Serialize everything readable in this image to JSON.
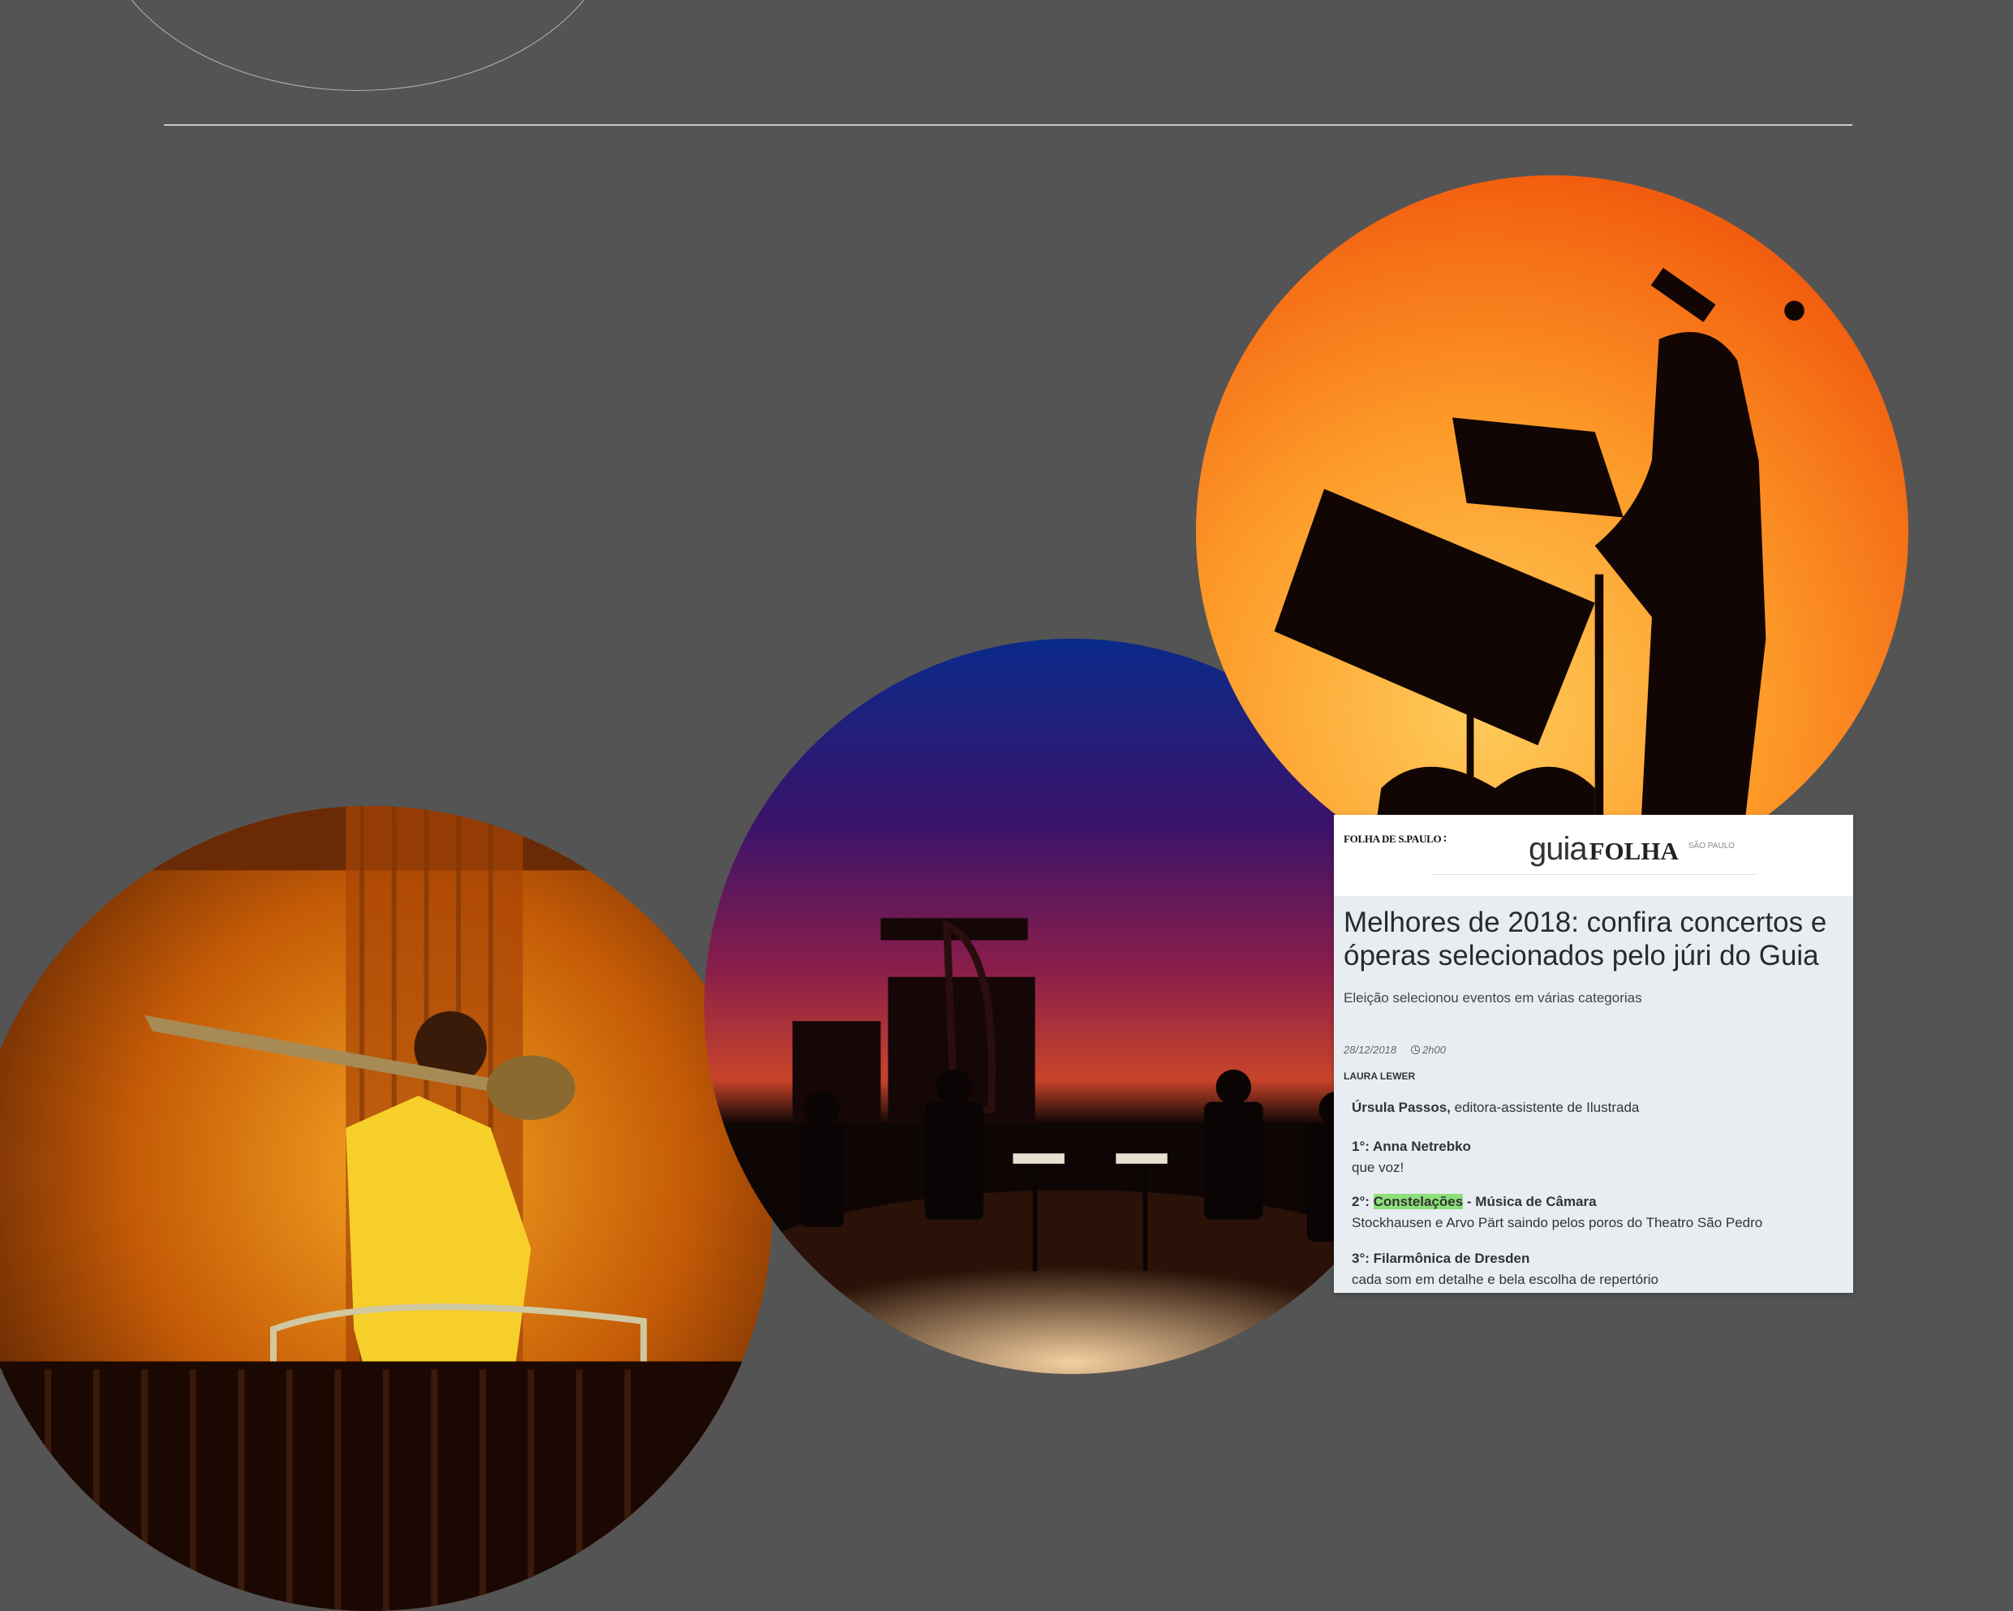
{
  "clipping": {
    "masthead": "FOLHA DE S.PAULO ∶",
    "brand_guia": "guia",
    "brand_folha": "FOLHA",
    "brand_city": "SÃO PAULO",
    "title": "Melhores de 2018: confira concertos e óperas selecionados pelo júri do Guia",
    "subtitle": "Eleição selecionou eventos em várias categorias",
    "date": "28/12/2018",
    "duration": "2h00",
    "author": "LAURA LEWER",
    "juror_name": "Úrsula Passos,",
    "juror_role": " editora-assistente de Ilustrada",
    "entries": [
      {
        "rank": "1°: ",
        "title": "Anna Netrebko",
        "title_rest": "",
        "desc": "que voz!"
      },
      {
        "rank": "2°: ",
        "title": "Constelações",
        "title_rest": " - Música de Câmara",
        "desc": "Stockhausen e Arvo Pärt saindo pelos poros do Theatro São Pedro"
      },
      {
        "rank": "3°: ",
        "title": "Filarmônica de Dresden",
        "title_rest": "",
        "desc": "cada som em detalhe e bela escolha de repertório"
      }
    ]
  }
}
